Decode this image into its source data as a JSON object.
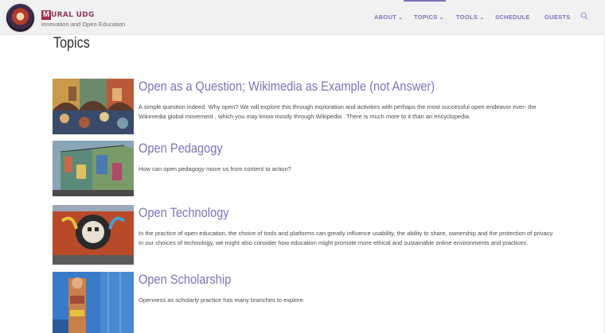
{
  "brand": {
    "initial": "M",
    "name_rest": "URAL UDG",
    "tagline": "Innovation and Open Education"
  },
  "nav": {
    "items": [
      {
        "label": "ABOUT",
        "has_menu": true
      },
      {
        "label": "TOPICS",
        "has_menu": true,
        "active": true
      },
      {
        "label": "TOOLS",
        "has_menu": true
      },
      {
        "label": "SCHEDULE",
        "has_menu": false
      },
      {
        "label": "GUESTS",
        "has_menu": false
      }
    ],
    "search_icon": "search-icon"
  },
  "page": {
    "title": "Topics"
  },
  "topics": [
    {
      "title": "Open as a Question; Wikimedia as Example (not Answer)",
      "description": "A simple question indeed. Why open? We will explore this through exploration and activities with perhaps the most successful open endeavor ever- the Wikimedia global movement , which you may know mostly through Wikipedia . There is much more to it than an encyclopedia."
    },
    {
      "title": "Open Pedagogy",
      "description": "How can open pedagogy move us from content to action?"
    },
    {
      "title": "Open Technology",
      "description": "In the practice of open education, the choice of tools and platforms can greatly influence usability, the ability to share, ownership and the protection of privacy. In our choices of technology, we might also consider how education might promote more ethical and sustainable online environments and practices."
    },
    {
      "title": "Open Scholarship",
      "description": "Openness as scholarly practice has many branches to explore."
    }
  ],
  "colors": {
    "accent": "#7b74b7",
    "brand": "#a0284a",
    "header_bg": "#f1f1f2"
  }
}
